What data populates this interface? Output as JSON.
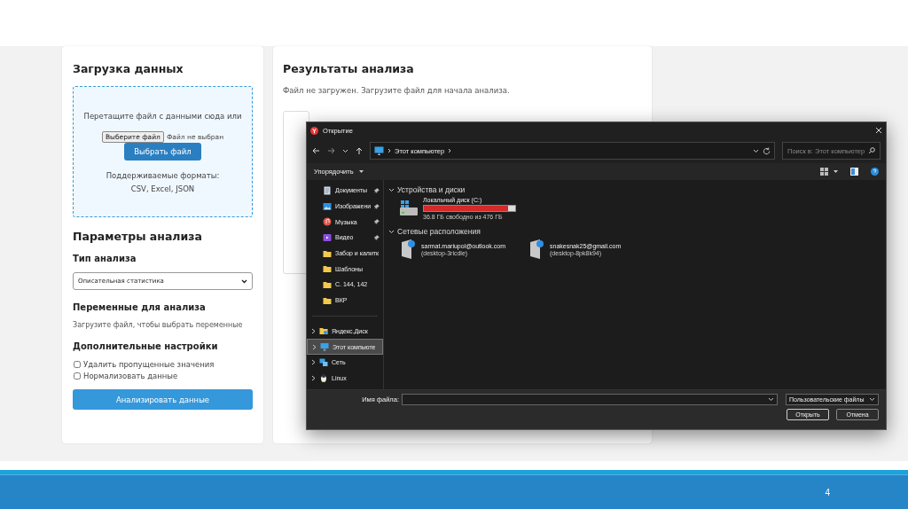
{
  "upload": {
    "title": "Загрузка данных",
    "drop_text": "Перетащите файл с данными сюда или",
    "file_button": "Выберите файл",
    "file_status": "Файл не выбран",
    "choose_button": "Выбрать файл",
    "formats": "Поддерживаемые форматы: CSV, Excel, JSON"
  },
  "params": {
    "title": "Параметры анализа",
    "type_label": "Тип анализа",
    "type_value": "Описательная статистика",
    "variables_label": "Переменные для анализа",
    "variables_hint": "Загрузите файл, чтобы выбрать переменные",
    "extra_label": "Дополнительные настройки",
    "options": [
      {
        "label": "Удалить пропущенные значения",
        "checked": false
      },
      {
        "label": "Нормализовать данные",
        "checked": false
      }
    ],
    "analyze_button": "Анализировать данные"
  },
  "results": {
    "title": "Результаты анализа",
    "message": "Файл не загружен. Загрузите файл для начала анализа."
  },
  "dialog": {
    "title": "Открытие",
    "path": "Этот компьютер",
    "search_placeholder": "Поиск в: Этот компьютер",
    "organize": "Упорядочить",
    "sidebar": [
      {
        "kind": "document",
        "label": "Документы",
        "pinned": true,
        "selected": false
      },
      {
        "kind": "image",
        "label": "Изображени",
        "pinned": true,
        "selected": false
      },
      {
        "kind": "music",
        "label": "Музыка",
        "pinned": true,
        "selected": false
      },
      {
        "kind": "video",
        "label": "Видео",
        "pinned": true,
        "selected": false
      },
      {
        "kind": "folder",
        "label": "Забор и калитк",
        "pinned": false,
        "selected": false
      },
      {
        "kind": "folder",
        "label": "Шаблоны",
        "pinned": false,
        "selected": false
      },
      {
        "kind": "folder",
        "label": "С. 144, 142",
        "pinned": false,
        "selected": false
      },
      {
        "kind": "folder",
        "label": "ВКР",
        "pinned": false,
        "selected": false
      },
      {
        "kind": "cloud",
        "label": "Яндекс.Диск",
        "selected": false
      },
      {
        "kind": "computer",
        "label": "Этот компьюте",
        "selected": true
      },
      {
        "kind": "network",
        "label": "Сеть",
        "selected": false
      },
      {
        "kind": "linux",
        "label": "Linux",
        "selected": false
      }
    ],
    "sections": [
      {
        "title": "Устройства и диски",
        "items": [
          {
            "kind": "drive",
            "name": "Локальный диск (C:)",
            "level": 0.92,
            "info": "36.8 ГБ свободно из 476 ГБ"
          }
        ]
      },
      {
        "title": "Сетевые расположения",
        "items": [
          {
            "kind": "network",
            "name": "sarmat.mariupol@outlook.com",
            "info": "(desktop-3ricdle)"
          },
          {
            "kind": "network",
            "name": "snakesnak25@gmail.com",
            "info": "(desktop-8pk8k94)"
          }
        ]
      }
    ],
    "file_name_label": "Имя файла:",
    "file_type": "Пользовательские файлы",
    "buttons": [
      "Открыть",
      "Отмена"
    ]
  },
  "slide": {
    "page_number": "4"
  }
}
